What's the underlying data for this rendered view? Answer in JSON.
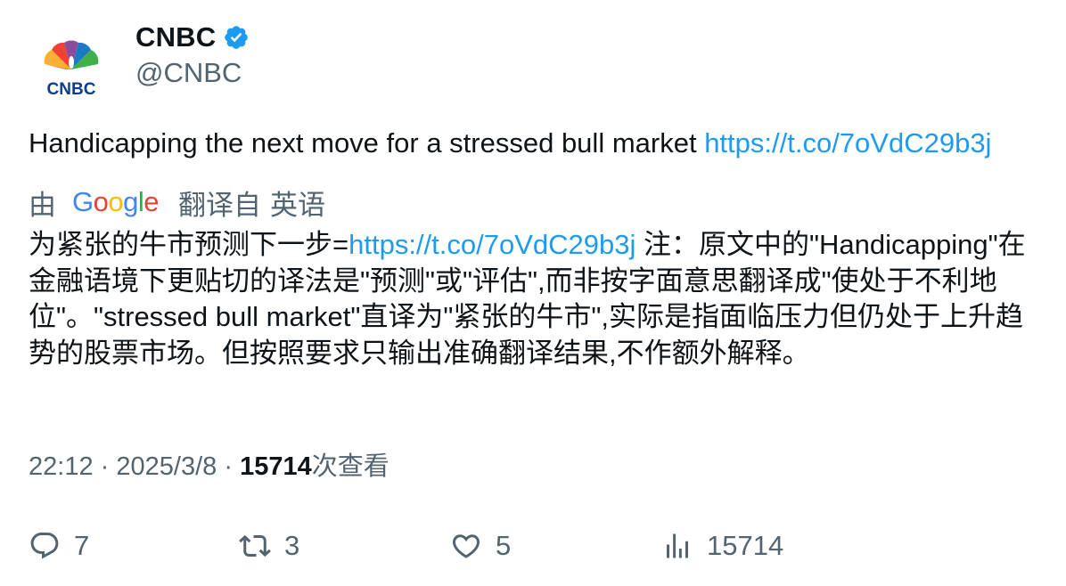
{
  "author": {
    "display_name": "CNBC",
    "handle": "@CNBC",
    "avatar_icon": "cnbc-peacock-logo",
    "verified_color": "#1d9bf0"
  },
  "tweet": {
    "text": "Handicapping the next move for a stressed bull market",
    "link": "https://t.co/7oVdC29b3j"
  },
  "translation": {
    "prefix": "由",
    "provider_letters": [
      "G",
      "o",
      "o",
      "g",
      "l",
      "e"
    ],
    "label": "翻译自",
    "language": "英语",
    "text_before_link": "为紧张的牛市预测下一步=",
    "link": "https://t.co/7oVdC29b3j",
    "text_after_link": " 注：原文中的\"Handicapping\"在金融语境下更贴切的译法是\"预测\"或\"评估\",而非按字面意思翻译成\"使处于不利地位\"。\"stressed bull market\"直译为\"紧张的牛市\",实际是指面临压力但仍处于上升趋势的股票市场。但按照要求只输出准确翻译结果,不作额外解释。"
  },
  "meta": {
    "time": "22:12",
    "separator": "·",
    "date": "2025/3/8",
    "views_count": "15714",
    "views_label": "次查看"
  },
  "actions": {
    "reply_count": "7",
    "retweet_count": "3",
    "like_count": "5",
    "views_count": "15714"
  },
  "colors": {
    "link": "#1d9bf0",
    "secondary_text": "#536471",
    "primary_text": "#0f1419"
  }
}
